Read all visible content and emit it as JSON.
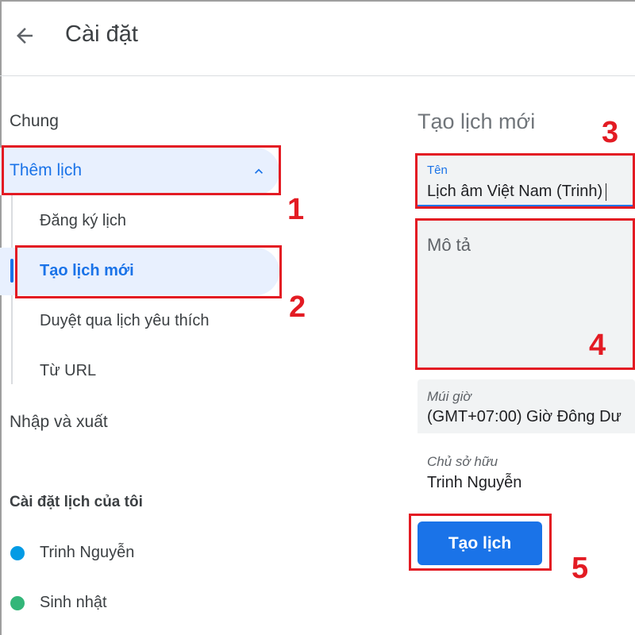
{
  "header": {
    "back_icon": "arrow-left-icon",
    "title": "Cài đặt"
  },
  "sidebar": {
    "general": "Chung",
    "add_calendar": {
      "label": "Thêm lịch",
      "icon": "chevron-up-icon",
      "items": [
        {
          "label": "Đăng ký lịch"
        },
        {
          "label": "Tạo lịch mới",
          "active": true
        },
        {
          "label": "Duyệt qua lịch yêu thích"
        },
        {
          "label": "Từ URL"
        }
      ]
    },
    "import_export": "Nhập và xuất",
    "my_calendars_title": "Cài đặt lịch của tôi",
    "my_calendars": [
      {
        "label": "Trinh Nguyễn",
        "color": "#039be5"
      },
      {
        "label": "Sinh nhật",
        "color": "#33b679"
      }
    ]
  },
  "form": {
    "title": "Tạo lịch mới",
    "name_label": "Tên",
    "name_value": "Lịch âm Việt Nam (Trinh)",
    "description_placeholder": "Mô tả",
    "timezone_label": "Múi giờ",
    "timezone_value": "(GMT+07:00) Giờ Đông Dư",
    "owner_label": "Chủ sở hữu",
    "owner_value": "Trinh Nguyễn",
    "create_button": "Tạo lịch"
  },
  "annotations": {
    "accent_color": "#e31b23",
    "steps": [
      "1",
      "2",
      "3",
      "4",
      "5"
    ]
  }
}
